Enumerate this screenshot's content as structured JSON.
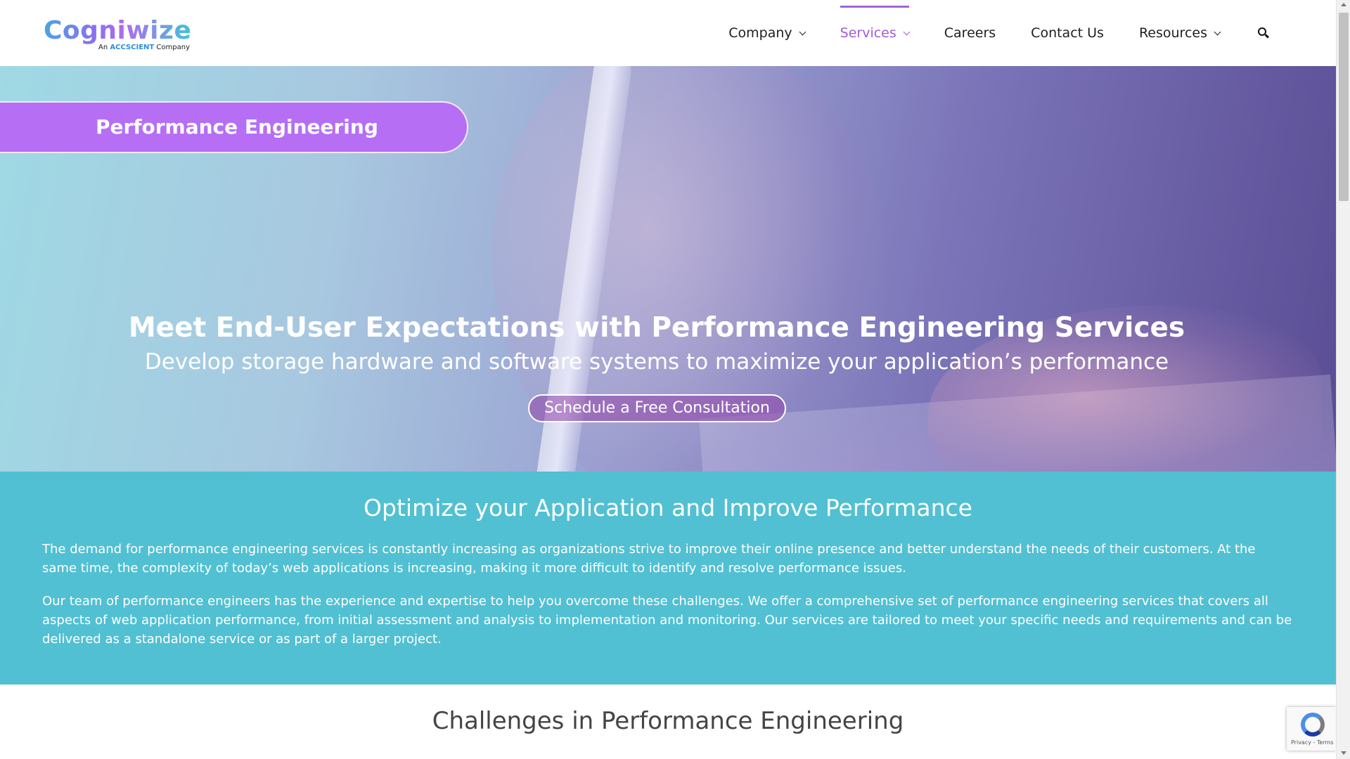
{
  "brand": {
    "logo_text": "Cogniwize",
    "tagline_prefix": "An ",
    "tagline_company": "ACCSCIENT",
    "tagline_suffix": " Company"
  },
  "nav": {
    "items": [
      {
        "label": "Company",
        "has_dropdown": true
      },
      {
        "label": "Services",
        "has_dropdown": true,
        "active": true
      },
      {
        "label": "Careers"
      },
      {
        "label": "Contact Us"
      },
      {
        "label": "Resources",
        "has_dropdown": true
      }
    ],
    "search_icon": "search-icon"
  },
  "hero": {
    "pill_label": "Performance Engineering",
    "title": "Meet End-User Expectations with Performance Engineering Services",
    "subtitle": "Develop storage hardware and software systems to maximize your application’s performance",
    "cta_label": "Schedule a Free Consultation"
  },
  "intro": {
    "heading": "Optimize your Application and Improve Performance",
    "paragraph_1": "The demand for performance engineering services is constantly increasing as organizations strive to improve their online presence and better understand the needs of their customers. At the same time, the complexity of today’s web applications is increasing, making it more difficult to identify and resolve performance issues.",
    "paragraph_2": "Our team of performance engineers has the experience and expertise to help you overcome these challenges. We offer a comprehensive set of performance engineering services that covers all aspects of web application performance, from initial assessment and analysis to implementation and monitoring. Our services are tailored to meet your specific needs and requirements and can be delivered as a standalone service or as part of a larger project."
  },
  "challenges": {
    "heading": "Challenges in Performance Engineering"
  },
  "recaptcha": {
    "footer_text": "Privacy - Terms"
  },
  "colors": {
    "accent_purple": "#b66ef5",
    "nav_active": "#9e5bd8",
    "section_teal": "#51c0d2"
  }
}
